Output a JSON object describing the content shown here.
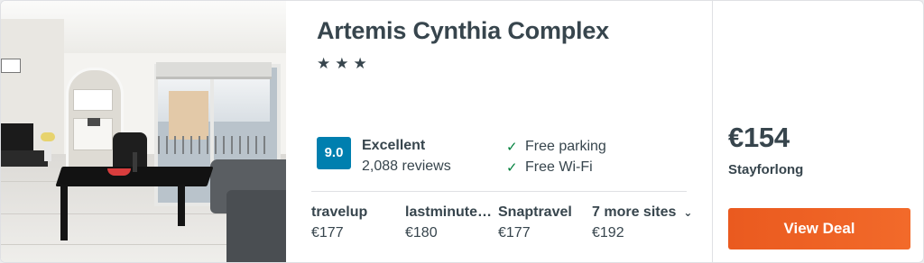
{
  "hotel": {
    "name": "Artemis Cynthia Complex",
    "star_count": 3,
    "stars": [
      "★",
      "★",
      "★"
    ]
  },
  "rating": {
    "score": "9.0",
    "label": "Excellent",
    "reviews": "2,088 reviews",
    "badge_color": "#007faf"
  },
  "amenities": [
    {
      "icon": "check-icon",
      "glyph": "✓",
      "label": "Free parking"
    },
    {
      "icon": "check-icon",
      "glyph": "✓",
      "label": "Free Wi-Fi"
    }
  ],
  "sites": [
    {
      "name": "travelup",
      "price": "€177"
    },
    {
      "name": "lastminute.com",
      "price": "€180"
    },
    {
      "name": "Snaptravel",
      "price": "€177"
    }
  ],
  "more_sites": {
    "label": "7 more sites",
    "price": "€192",
    "icon": "chevron-down-icon",
    "glyph": "⌄"
  },
  "deal": {
    "price": "€154",
    "provider": "Stayforlong",
    "button_label": "View Deal",
    "button_color": "#f26a2a"
  },
  "colors": {
    "text": "#37454d",
    "check": "#00813d"
  }
}
